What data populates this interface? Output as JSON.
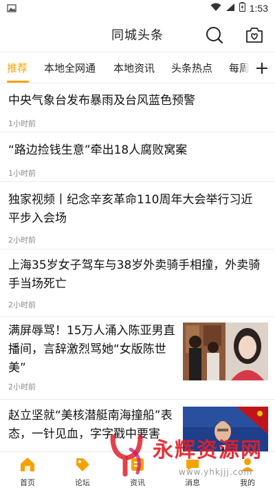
{
  "status_bar": {
    "time": "1:53",
    "icons": [
      "image-icon",
      "wifi-icon",
      "signal-icon",
      "battery-icon"
    ]
  },
  "header": {
    "title": "同城头条",
    "icons": [
      "search-icon",
      "favorites-icon"
    ]
  },
  "tabs": {
    "items": [
      "推荐",
      "本地全网通",
      "本地资讯",
      "头条热点",
      "每周"
    ],
    "active": "推荐",
    "add_icon": "plus-icon",
    "accent_color": "#f5a100"
  },
  "news": [
    {
      "title_lines": [
        "中央气象台发布暴雨及台风蓝色预警"
      ],
      "time": "1小时前",
      "has_thumb": false
    },
    {
      "title_lines": [
        "“路边捡钱生意”牵出18人腐败窝案"
      ],
      "time": "1小时前",
      "has_thumb": false
    },
    {
      "title_lines": [
        "独家视频丨纪念辛亥革命110周年大会举行习近",
        "平步入会场"
      ],
      "time": "2小时前",
      "has_thumb": false
    },
    {
      "title_lines": [
        "上海35岁女子驾车与38岁外卖骑手相撞，外卖骑",
        "手当场死亡"
      ],
      "time": "2小时前",
      "has_thumb": false
    },
    {
      "title_lines": [
        "满屏辱骂！15万人涌入陈亚男直",
        "播间，言辞激烈骂她“女版陈世",
        "美”"
      ],
      "time": "2小时前",
      "has_thumb": true
    },
    {
      "title_lines": [
        "赵立坚就“美核潜艇南海撞船”表",
        "态，一针见血，字字戳中要害"
      ],
      "time": "",
      "has_thumb": true
    }
  ],
  "bottom_nav": {
    "items": [
      {
        "label": "首页",
        "icon": "home-icon"
      },
      {
        "label": "论坛",
        "icon": "tag-icon"
      },
      {
        "label": "资讯",
        "icon": "news-icon"
      },
      {
        "label": "消息",
        "icon": "message-icon"
      },
      {
        "label": "我的",
        "icon": "profile-icon"
      }
    ]
  },
  "watermark": {
    "text": "永辉资源网",
    "url": "www.yhkjjj.com"
  }
}
